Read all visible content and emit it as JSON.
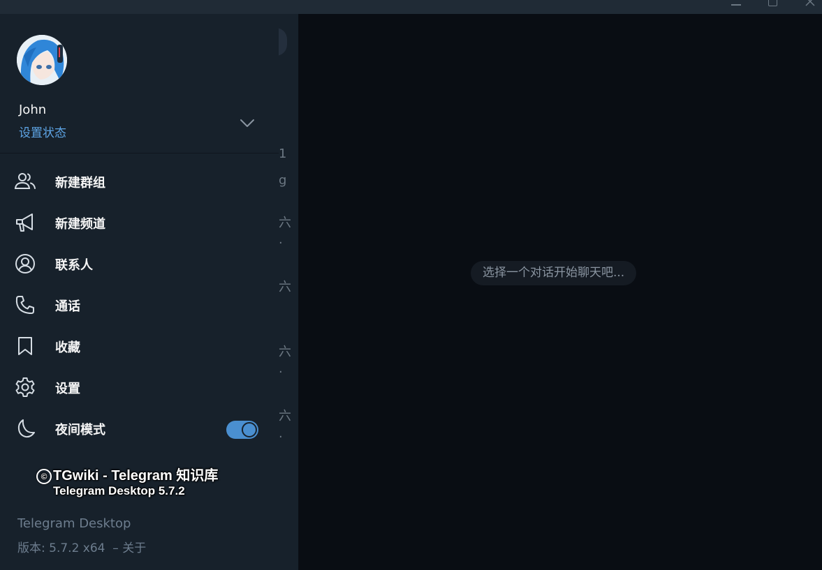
{
  "window": {
    "controls": [
      "minimize",
      "maximize",
      "close"
    ]
  },
  "user": {
    "name": "John",
    "status_link": "设置状态"
  },
  "menu": [
    {
      "id": "new-group",
      "label": "新建群组",
      "icon": "users-icon"
    },
    {
      "id": "new-channel",
      "label": "新建频道",
      "icon": "megaphone-icon"
    },
    {
      "id": "contacts",
      "label": "联系人",
      "icon": "user-circle-icon"
    },
    {
      "id": "calls",
      "label": "通话",
      "icon": "phone-icon"
    },
    {
      "id": "saved",
      "label": "收藏",
      "icon": "bookmark-icon"
    },
    {
      "id": "settings",
      "label": "设置",
      "icon": "gear-icon"
    },
    {
      "id": "night-mode",
      "label": "夜间模式",
      "icon": "moon-icon",
      "toggle_on": true
    }
  ],
  "watermark": {
    "symbol": "©",
    "line1": "TGwiki - Telegram 知识库",
    "line2": "Telegram Desktop 5.7.2"
  },
  "footer": {
    "app_name": "Telegram Desktop",
    "version": "版本: 5.7.2 x64",
    "about": "– 关于"
  },
  "chat": {
    "empty_placeholder": "选择一个对话开始聊天吧..."
  },
  "dialogs_peek": [
    "1",
    "g",
    "六",
    "·",
    "六",
    "六",
    "·",
    "六",
    "·"
  ],
  "colors": {
    "accent": "#5ea5e6",
    "toggle": "#4a8fd0",
    "sidebar_bg": "#17212b",
    "chat_bg": "#090d13"
  }
}
